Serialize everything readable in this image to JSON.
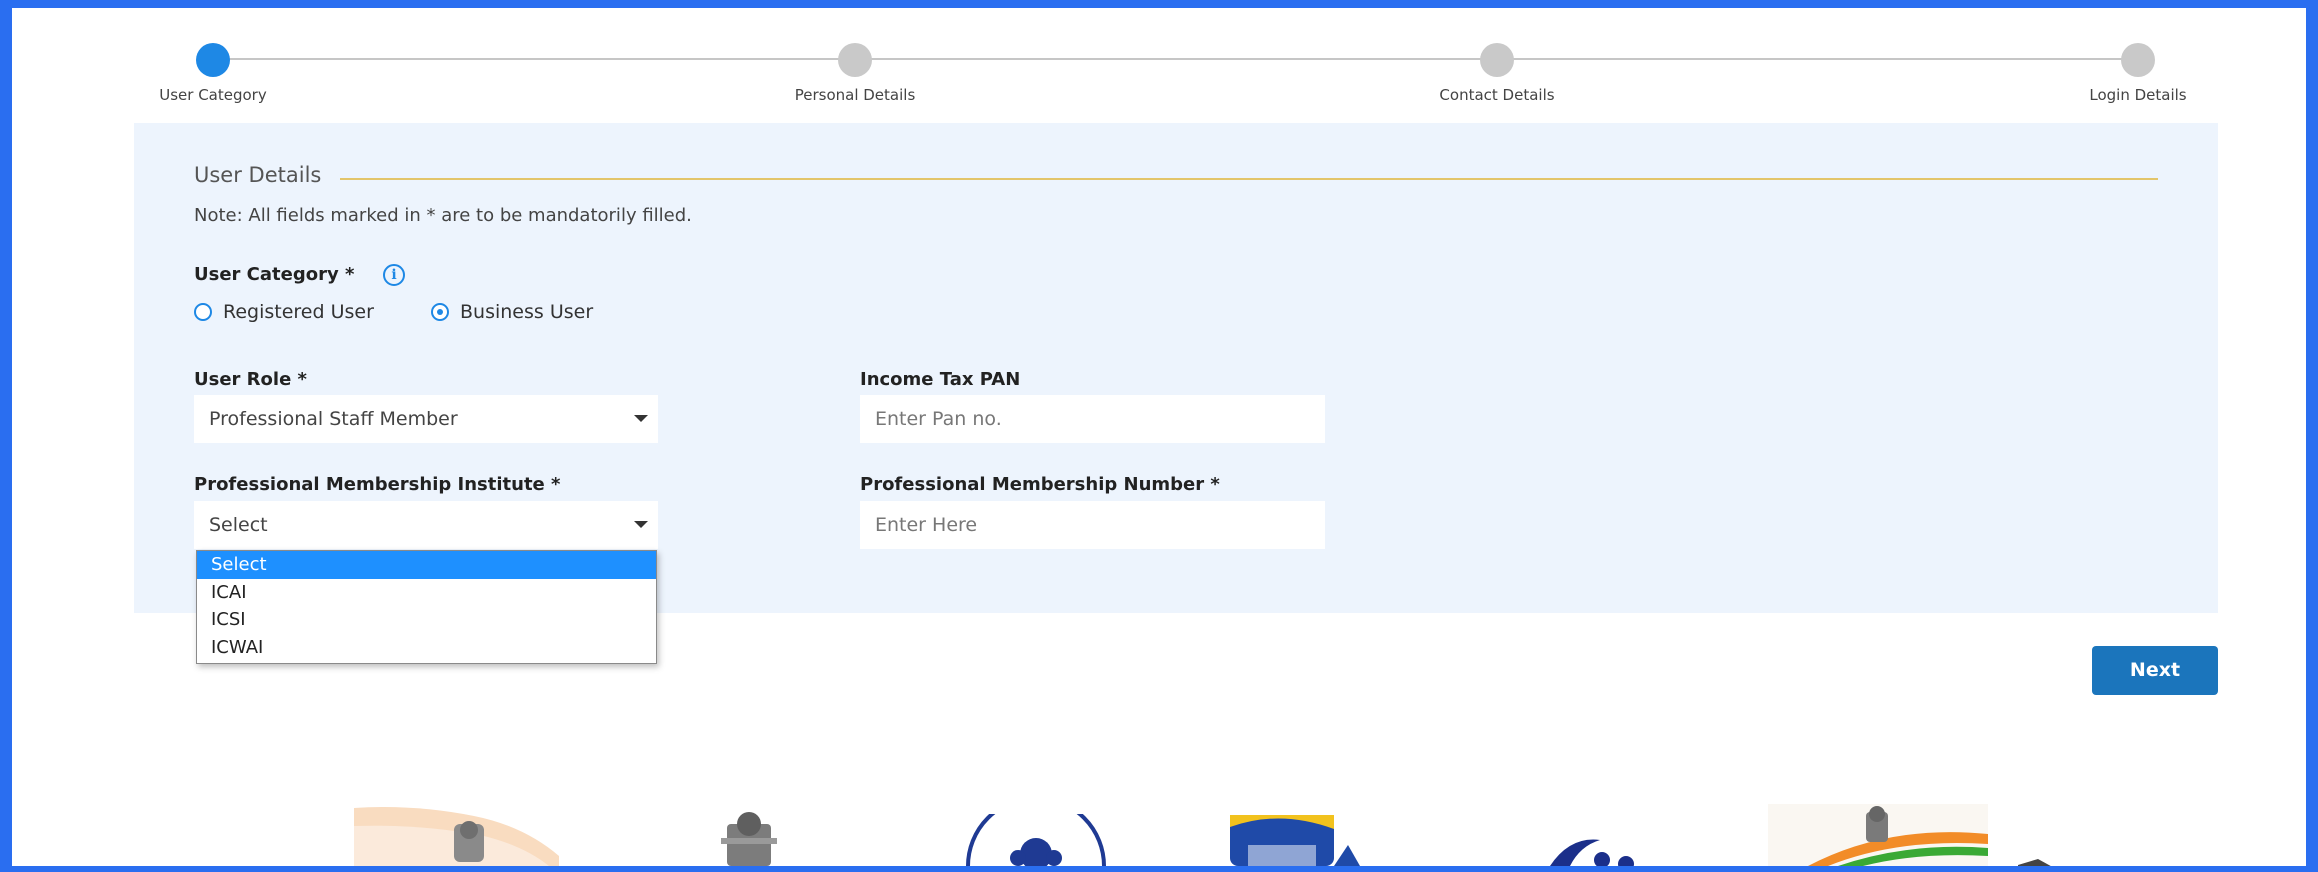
{
  "stepper": {
    "steps": [
      {
        "label": "User Category",
        "active": true
      },
      {
        "label": "Personal Details",
        "active": false
      },
      {
        "label": "Contact Details",
        "active": false
      },
      {
        "label": "Login Details",
        "active": false
      }
    ]
  },
  "form": {
    "section_title": "User Details",
    "note": "Note: All fields marked in * are to be mandatorily filled.",
    "user_category": {
      "label": "User Category *",
      "options": [
        {
          "label": "Registered User",
          "checked": false
        },
        {
          "label": "Business User",
          "checked": true
        }
      ]
    },
    "user_role": {
      "label": "User Role *",
      "value": "Professional Staff Member"
    },
    "income_tax_pan": {
      "label": "Income Tax PAN",
      "placeholder": "Enter Pan no."
    },
    "membership_institute": {
      "label": "Professional Membership Institute *",
      "value": "Select",
      "options": [
        "Select",
        "ICAI",
        "ICSI",
        "ICWAI"
      ]
    },
    "membership_number": {
      "label": "Professional Membership Number *",
      "placeholder": "Enter Here"
    },
    "next_label": "Next"
  },
  "colors": {
    "accent": "#1e88e5",
    "panel_bg": "#edf4fd",
    "button": "#1b75bc",
    "frame": "#2a6ef0",
    "rule": "#e3c56a"
  }
}
